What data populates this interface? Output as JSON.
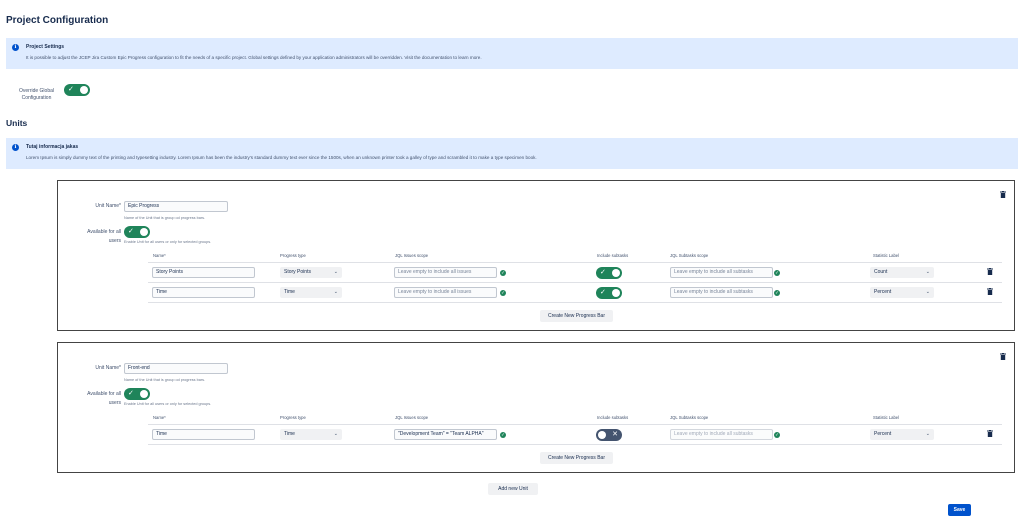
{
  "page": {
    "title": "Project Configuration"
  },
  "project_settings": {
    "banner_title": "Project Settings",
    "banner_text": "It is possible to adjust the JCEP Jira Custom Epic Progress configuration to fit the needs of a specific project. Global settings defined by your application administrators will be overridden. Visit the documentation to learn more.",
    "override_label_1": "Override Global",
    "override_label_2": "Configuration",
    "override_enabled": true
  },
  "units": {
    "title": "Units",
    "banner_title": "Tutaj informacja jakas",
    "banner_text": "Lorem Ipsum is simply dummy text of the printing and typesetting industry. Lorem Ipsum has been the industry's standard dummy text ever since the 1500s, when an unknown printer took a galley of type and scrambled it to make a type specimen book.",
    "unit_name_label": "Unit Name*",
    "unit_name_help": "Name of the Unit that is group od progress bars.",
    "available_label_1": "Available for all",
    "available_label_2": "users",
    "available_help": "Enable Unit for all users or only for selected groups.",
    "columns": {
      "name": "Name*",
      "progress_type": "Progress type",
      "jql_issues": "JQL Issues scope",
      "include_subtasks": "Include subtasks",
      "jql_subtasks": "JQL Subtasks scope",
      "statistic_label": "Statistic Label"
    },
    "jql_issues_placeholder": "Leave empty to include all issues",
    "jql_subtasks_placeholder": "Leave empty to include all subtasks",
    "create_bar_label": "Create New Progress Bar",
    "list": [
      {
        "name": "Epic Progress",
        "available_for_all": true,
        "rows": [
          {
            "name": "Story Points",
            "progress_type": "Story Points",
            "jql_issues": "",
            "include_subtasks": true,
            "jql_subtasks": "",
            "statistic_label": "Count"
          },
          {
            "name": "Time",
            "progress_type": "Time",
            "jql_issues": "",
            "include_subtasks": true,
            "jql_subtasks": "",
            "statistic_label": "Percent"
          }
        ]
      },
      {
        "name": "Front-end",
        "available_for_all": true,
        "rows": [
          {
            "name": "Time",
            "progress_type": "Time",
            "jql_issues": "\"Development Team\" = \"Team ALPHA\"",
            "include_subtasks": false,
            "jql_subtasks": "",
            "statistic_label": "Percent"
          }
        ]
      }
    ],
    "add_unit_label": "Add new Unit",
    "save_label": "Save"
  },
  "icons": {
    "info": "info-icon",
    "trash": "trash-icon",
    "check": "check-icon",
    "cross": "cross-icon",
    "chevron": "chevron-down-icon"
  },
  "colors": {
    "primary": "#0052cc",
    "toggle_on": "#1f845a",
    "toggle_off": "#44546f",
    "banner": "#deebff"
  }
}
